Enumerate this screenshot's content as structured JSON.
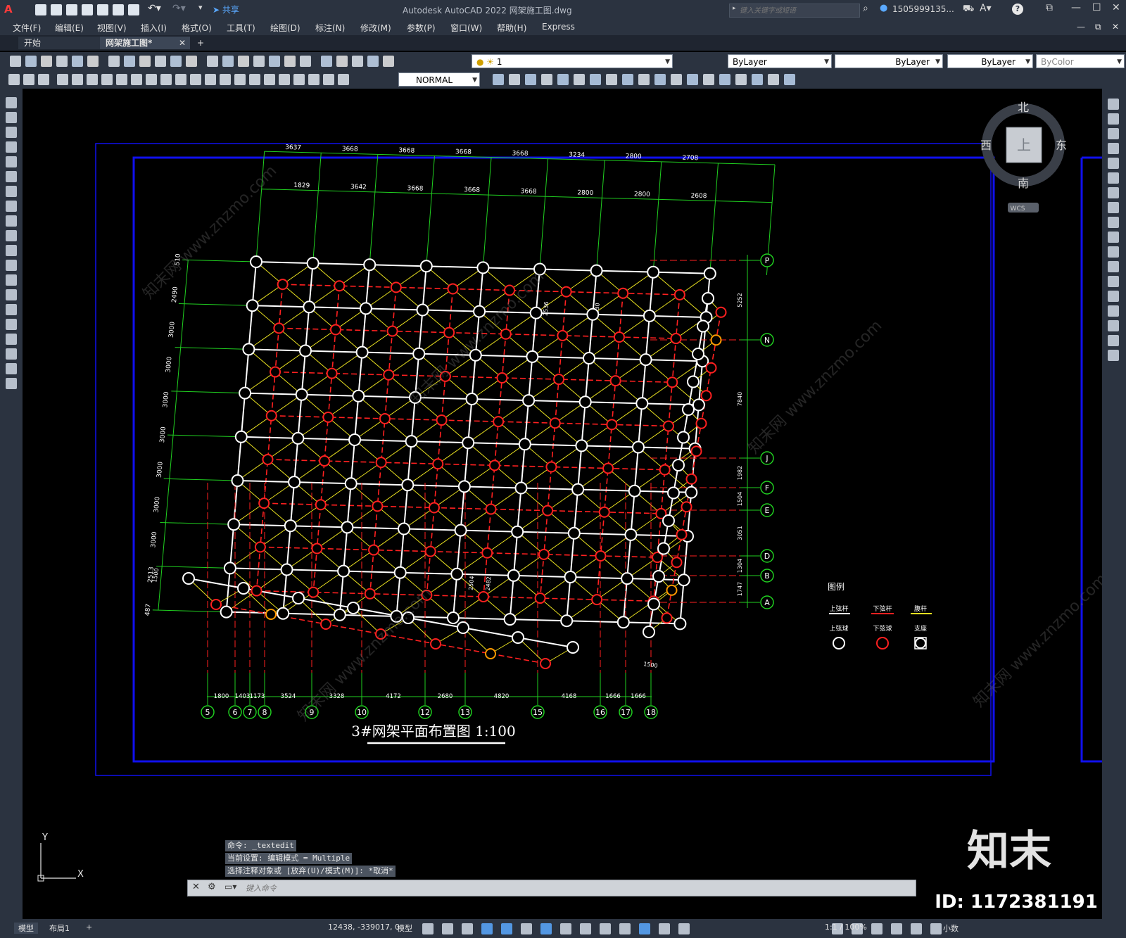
{
  "titlebar": {
    "app_title": "Autodesk AutoCAD 2022    网架施工图.dwg",
    "share_label": "共享",
    "search_placeholder": "键入关键字或短语",
    "user": "1505999135...",
    "help": "?"
  },
  "menu": [
    "文件(F)",
    "编辑(E)",
    "视图(V)",
    "插入(I)",
    "格式(O)",
    "工具(T)",
    "绘图(D)",
    "标注(N)",
    "修改(M)",
    "参数(P)",
    "窗口(W)",
    "帮助(H)",
    "Express"
  ],
  "tabs": {
    "start": "开始",
    "drawing": "网架施工图*",
    "add": "+",
    "close": "✕"
  },
  "toolbar": {
    "layer_value": "1",
    "color_value": "ByLayer",
    "linetype_value": "ByLayer",
    "lineweight_value": "ByLayer",
    "plotstyle_value": "ByColor",
    "dimstyle_value": "NORMAL"
  },
  "viewcube": {
    "north": "北",
    "south": "南",
    "east": "东",
    "west": "西",
    "top": "上",
    "wcs": "WCS"
  },
  "drawing": {
    "title": "3#网架平面布置图 1:100",
    "top_dims": [
      "3637",
      "1829",
      "3668",
      "3642",
      "3668",
      "3668",
      "3668",
      "3668",
      "3668",
      "3668",
      "3234",
      "2800",
      "2800",
      "2800",
      "2708",
      "2608"
    ],
    "left_dims": [
      "510",
      "2490",
      "3000",
      "3000",
      "3000",
      "3000",
      "3000",
      "3000",
      "3000",
      "2513",
      "487"
    ],
    "inner_dims": [
      "2536",
      "2430",
      "2504",
      "2482"
    ],
    "bottom_axes": [
      "5",
      "6",
      "7",
      "8",
      "9",
      "10",
      "12",
      "13",
      "15",
      "16",
      "17",
      "18"
    ],
    "bottom_dims": [
      "1800",
      "1403",
      "1173",
      "3524",
      "3328",
      "4172",
      "2680",
      "4820",
      "4168",
      "1666",
      "1666"
    ],
    "right_axes": [
      "P",
      "N",
      "J",
      "F",
      "E",
      "D",
      "B",
      "A"
    ],
    "right_dims": [
      "5252",
      "7840",
      "1982",
      "1504",
      "3051",
      "1304",
      "1747"
    ],
    "side_dim_left": "1500",
    "side_dim_right": "1500",
    "legend": {
      "title": "图例",
      "items": [
        {
          "label": "上弦杆",
          "node_label": "上弦球",
          "color": "#ffffff"
        },
        {
          "label": "下弦杆",
          "node_label": "下弦球",
          "color": "#ff2020"
        },
        {
          "label": "腹杆",
          "node_label": "支座",
          "color": "#e8e020"
        }
      ]
    }
  },
  "ucs": {
    "x": "X",
    "y": "Y"
  },
  "command": {
    "history": [
      "命令: _textedit",
      "当前设置: 编辑模式 = Multiple",
      "选择注释对象或 [放弃(U)/模式(M)]: *取消*"
    ],
    "placeholder": "键入命令"
  },
  "layout_tabs": [
    "模型",
    "布局1",
    "+"
  ],
  "status": {
    "coords": "12438, -339017, 0",
    "model": "模型",
    "scale": "1:1 / 100%",
    "units": "小数"
  },
  "watermark": {
    "brand": "知末",
    "id": "ID: 1172381191",
    "site": "知末网 www.znzmo.com"
  },
  "colors": {
    "frame_blue": "#1010ee",
    "upper_chord": "#ffffff",
    "lower_chord": "#ff2020",
    "web": "#e8e020",
    "axis_green": "#20d020",
    "support": "#ff9a00"
  }
}
